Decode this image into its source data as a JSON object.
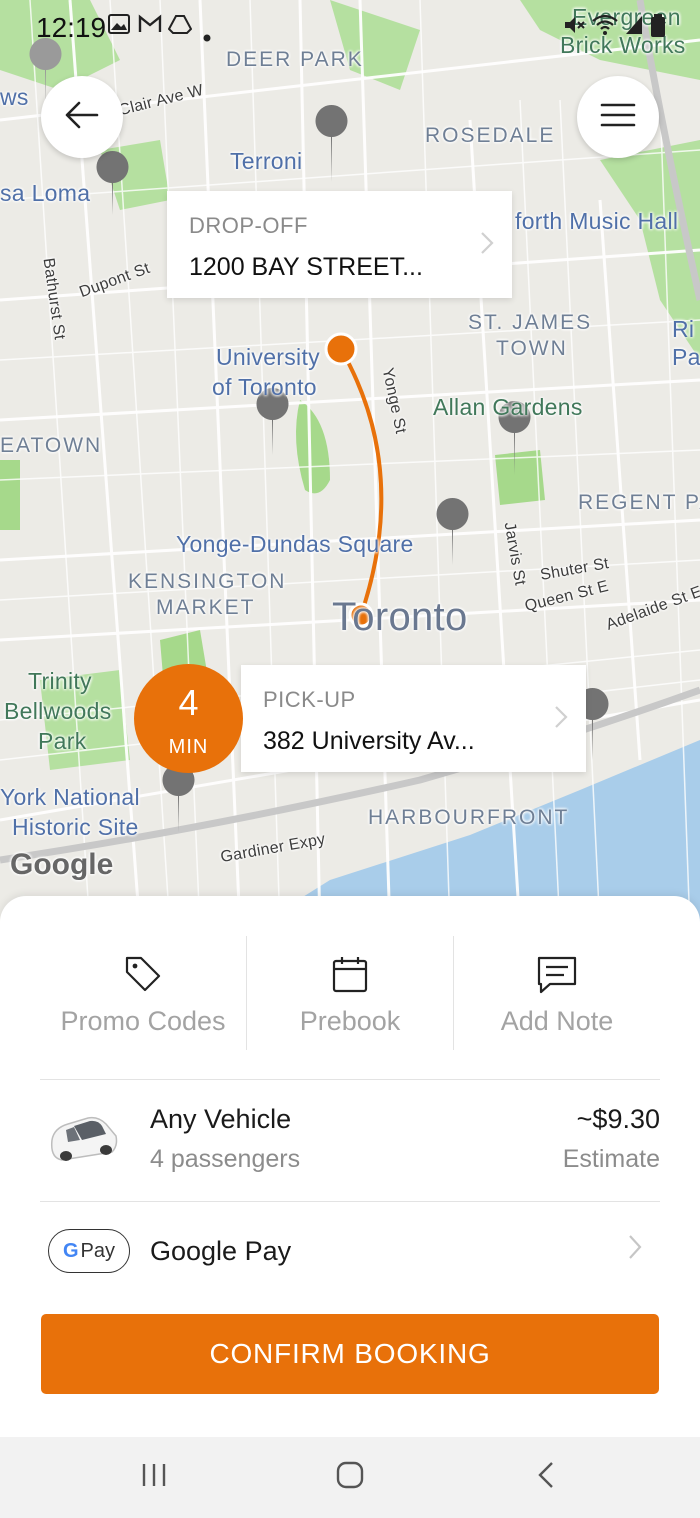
{
  "status_bar": {
    "time": "12:19",
    "left_icons": [
      "image-icon",
      "gmail-icon",
      "drive-icon",
      "dot-icon"
    ],
    "right_icons": [
      "mute-icon",
      "wifi-icon",
      "signal-icon",
      "battery-icon"
    ]
  },
  "map": {
    "labels": {
      "deer_park": "DEER PARK",
      "clair_ave": "Clair Ave W",
      "rosedale": "ROSEDALE",
      "terroni": "Terroni",
      "casa_loma": "sa Loma",
      "danforth": "forth Music Hall",
      "evergreen": "Evergreen",
      "brick_works": "Brick Works",
      "dupont": "Dupont St",
      "bathurst": "Bathurst St",
      "st_james_1": "ST. JAMES",
      "st_james_2": "TOWN",
      "university_1": "University",
      "university_2": "of Toronto",
      "yonge_st": "Yonge St",
      "allan_gardens": "Allan Gardens",
      "chinatown": "EATOWN",
      "regent_park": "REGENT PA",
      "yonge_dundas": "Yonge-Dundas Square",
      "jarvis": "Jarvis St",
      "shuter": "Shuter St",
      "queen": "Queen St E",
      "adelaide": "Adelaide St E",
      "kensington_1": "KENSINGTON",
      "kensington_2": "MARKET",
      "toronto": "Toronto",
      "trinity_1": "Trinity",
      "trinity_2": "Bellwoods",
      "trinity_3": "Park",
      "york_1": "York National",
      "york_2": "Historic Site",
      "harbourfront": "HARBOURFRONT",
      "gardiner": "Gardiner Expy",
      "google": "Google",
      "ws": "ws",
      "ri": "Ri",
      "pa": "Pa"
    },
    "route_color": "#e8710a",
    "back_icon": "arrow-left-icon",
    "menu_icon": "hamburger-menu-icon"
  },
  "dropoff": {
    "caption": "DROP-OFF",
    "address": "1200 BAY STREET..."
  },
  "pickup": {
    "caption": "PICK-UP",
    "address": "382 University Av..."
  },
  "eta": {
    "value": "4",
    "unit": "MIN"
  },
  "actions": [
    {
      "label": "Promo Codes",
      "icon": "tag-icon"
    },
    {
      "label": "Prebook",
      "icon": "calendar-icon"
    },
    {
      "label": "Add Note",
      "icon": "message-icon"
    }
  ],
  "vehicle": {
    "name": "Any Vehicle",
    "capacity": "4 passengers",
    "price": "~$9.30",
    "estimate_label": "Estimate",
    "icon": "car-icon"
  },
  "payment": {
    "badge_g": "G",
    "badge_pay": "Pay",
    "label": "Google Pay"
  },
  "confirm_label": "CONFIRM BOOKING",
  "nav_bar": {
    "icons": [
      "recent-apps-icon",
      "home-icon",
      "back-icon"
    ]
  },
  "colors": {
    "accent": "#e8710a",
    "map_park": "#a6d98b",
    "map_water": "#a9cdea"
  }
}
